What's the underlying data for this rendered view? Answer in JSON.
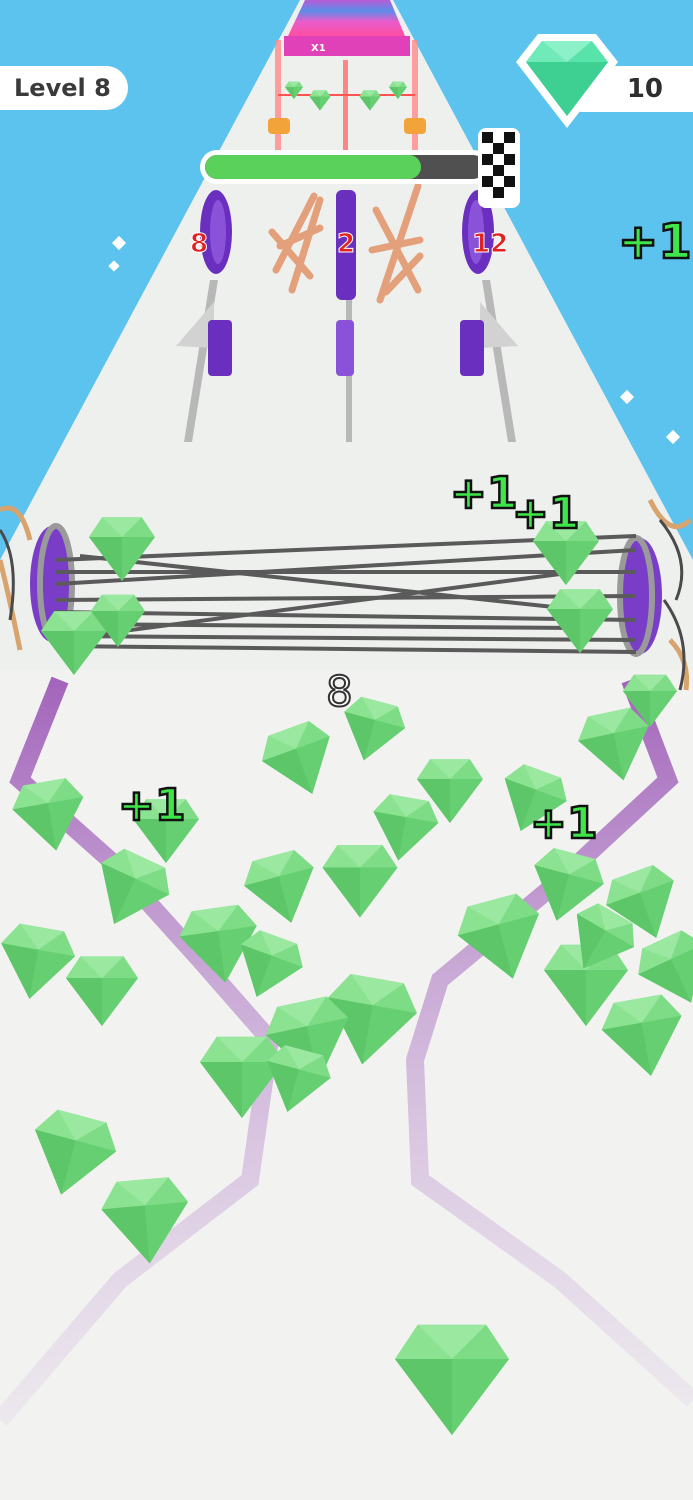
{
  "hud": {
    "level_label": "Level 8",
    "gem_count": "10",
    "progress": 0.77
  },
  "gates": [
    {
      "value": "8"
    },
    {
      "value": "2"
    },
    {
      "value": "12"
    }
  ],
  "track": {
    "multiplier_label": "X1"
  },
  "popups": [
    "+1",
    "+1",
    "+1",
    "+1",
    "+1"
  ],
  "rope_count": "8",
  "colors": {
    "sky": "#5cc3ee",
    "road": "#eef0ee",
    "gem": "#7fdc86",
    "gem_dark": "#4fbf5c",
    "gate": "#6a2fbf",
    "progress": "#5ad15a",
    "popup": "#3ee64a"
  }
}
